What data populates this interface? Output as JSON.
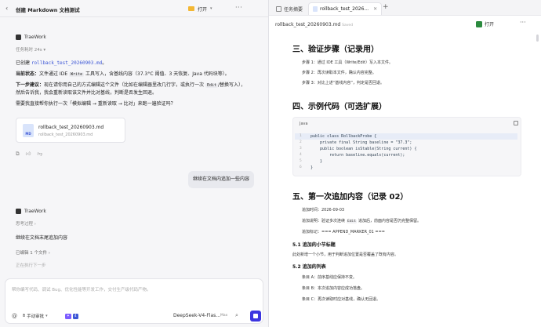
{
  "left": {
    "title": "创建 Markdown 文档测试",
    "open_label": "打开",
    "more": "···",
    "agent_name": "TraeWork",
    "task_time": "任务耗时 24s",
    "msg1": {
      "prefix": "已创建",
      "filename": "rollback_test_20260903.md",
      "suffix": "。"
    },
    "msg2": {
      "label": "当前状态：",
      "a": "文件通过 IDE",
      "chip": "Write",
      "b": "工具写入，含基线内容（37.3°C 阈值、3 天恢复、Java 代码块等）。"
    },
    "msg3": {
      "label": "下一步建议：",
      "a": "现在请你用自己的方式编辑这个文件（比如在编辑器里改几行字，或执行一次",
      "chip": "Edit",
      "b": "/替换写入），"
    },
    "msg4": "然后告诉我，我会重新读取该文件并比对基线，判断是否发生回退。",
    "msg5": "需要我直接帮你执行一次「模拟编辑 → 重新读取 → 比对」来跑一遍验证吗？",
    "file_card": {
      "icon_text": "MD",
      "name": "rollback_test_20260903.md",
      "path": "rollback_test_20260903.md"
    },
    "user_message": "继续在文档内追加一些内容",
    "agent_name2": "TraeWork",
    "thinking": "思考过程",
    "summary": "继续在文档末尾追加内容",
    "steps": "已编辑 1 个文件",
    "running": "正在执行下一步",
    "composer": {
      "placeholder": "帮你编写代码、调试 Bug、优化性能等开发工作，交付生产级代码产物。",
      "at": "@",
      "mode": "手动审批",
      "model": "DeepSeek-V4-Flas...",
      "max": "Max",
      "badge_colors": [
        "#7c5cff",
        "#3c56d6"
      ]
    }
  },
  "right": {
    "tabs": [
      {
        "label": "任务摘要"
      },
      {
        "label": "rollback_test_2026..."
      }
    ],
    "doc_name": "rollback_test_20260903.md",
    "saved": "Saved",
    "open_label": "打开",
    "more": "···",
    "s3": {
      "heading": "三、验证步骤（记录用）",
      "steps": [
        "步骤 1：通过 IDE 工具（Write/Edit）写入本文件。",
        "步骤 2：再次读取本文件，确认内容完整。",
        "步骤 3：对比上述“基线内容”，判定是否回退。"
      ]
    },
    "s4": {
      "heading": "四、示例代码（可选扩展）"
    },
    "code": {
      "lang": "Java",
      "line_numbers": [
        "1",
        "2",
        "3",
        "4",
        "5",
        "6"
      ],
      "lines": [
        "public class RollbackProbe {",
        "    private final String baseline = \"37.3\";",
        "    public boolean isStable(String current) {",
        "        return baseline.equals(current);",
        "    }",
        "}"
      ]
    },
    "s5": {
      "heading": "五、第一次追加内容（记录 02）",
      "time": "追加时间：2026-09-03",
      "desc_a": "追加说明：验证多次连续",
      "desc_chip": "Edit",
      "desc_b": "追加后，前面内容是否仍完整保留。",
      "marker": "追加标记：=== APPEND_MARKER_01 ===",
      "sub1": "5.1 追加的小节标题",
      "sub1_text": "此处新增一个小节，用于判断追加位置是否覆盖了既有内容。",
      "sub2": "5.2 追加的列表",
      "items": [
        "条目 A：前序基线应保持不变。",
        "条目 B：本次追加内容应成功落盘。",
        "条目 C：再次读取时应对基线，确认无回退。"
      ]
    }
  }
}
